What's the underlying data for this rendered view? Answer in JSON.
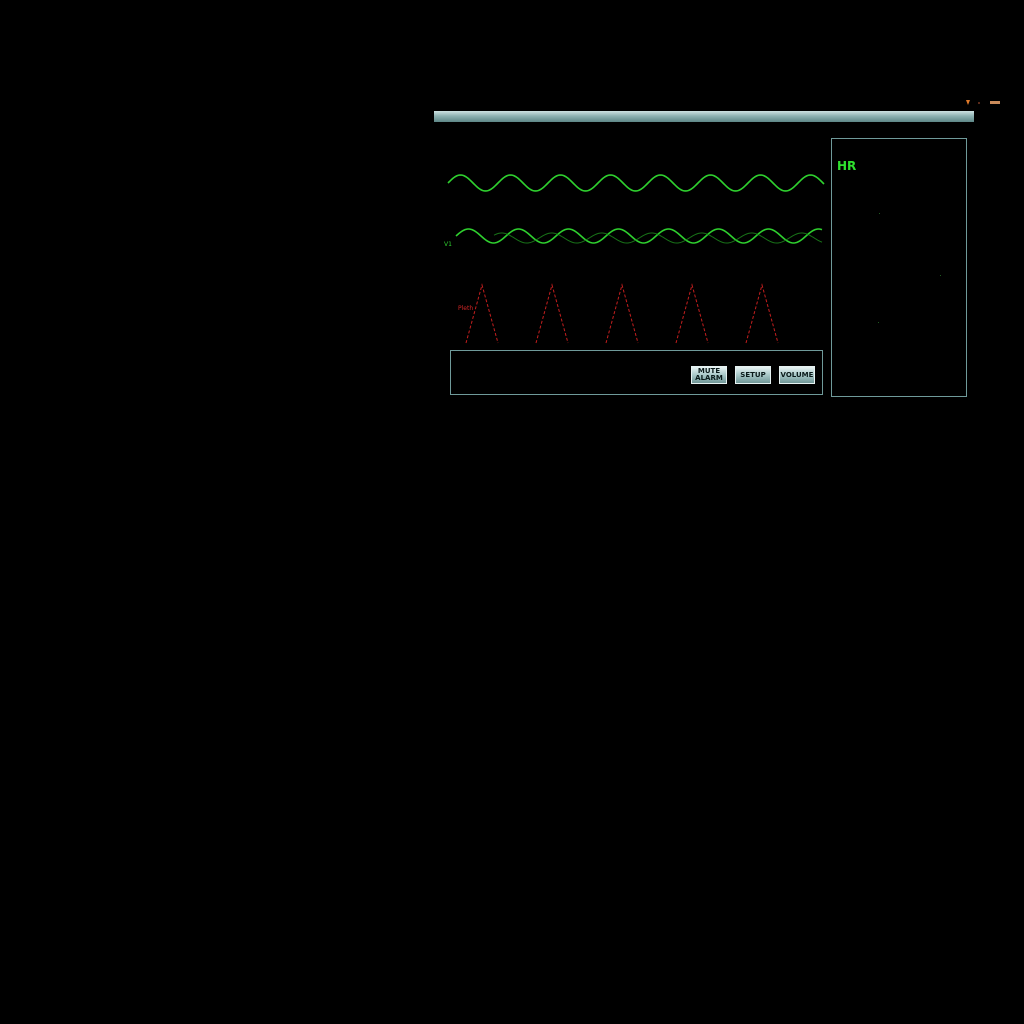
{
  "status_icons": [
    "warning-icon",
    "bell-icon",
    "battery-icon"
  ],
  "waveforms": {
    "lead_label": "V1",
    "pleth_label": "Pleth"
  },
  "controls": {
    "mute_alarm_line1": "MUTE",
    "mute_alarm_line2": "ALARM",
    "setup_label": "SETUP",
    "volume_label": "VOLUME"
  },
  "vitals": {
    "hr_label": "HR"
  },
  "colors": {
    "ecg_green": "#2fd12f",
    "pleth_red": "#d02525",
    "frame": "#6f9a9a",
    "title_bar": "#8fb3b3"
  }
}
